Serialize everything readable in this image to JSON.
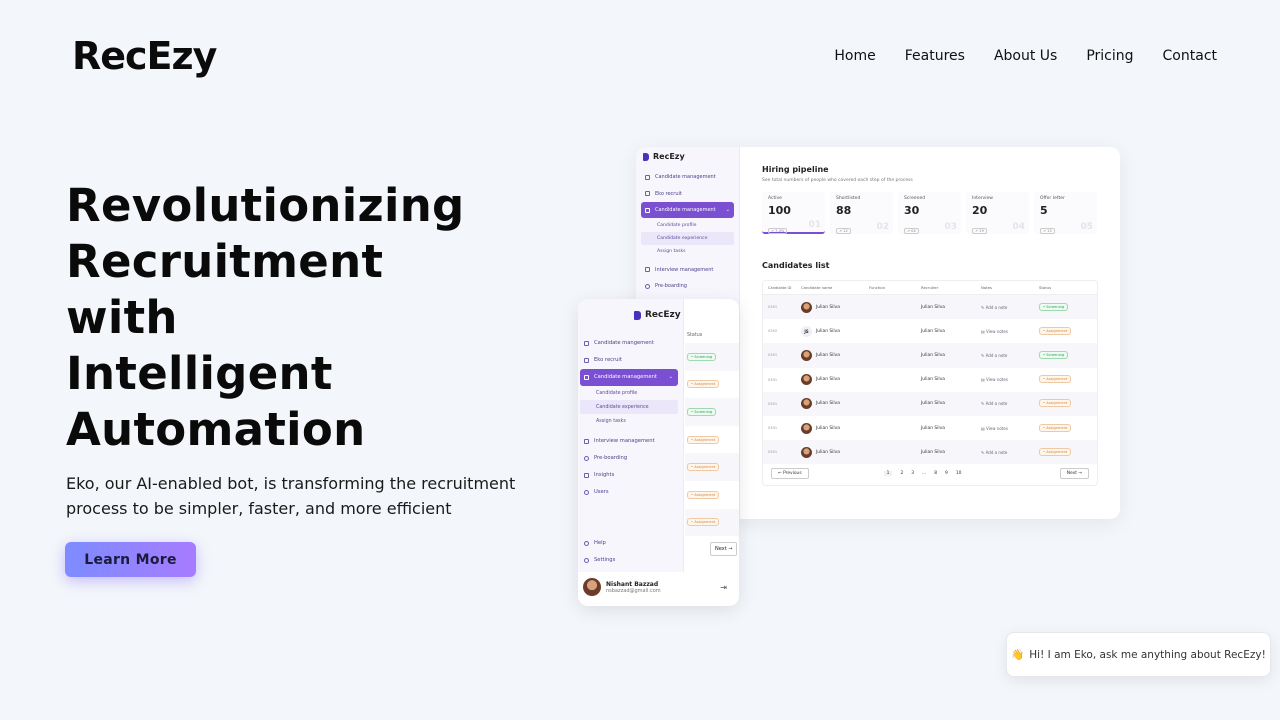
{
  "brand": "RecEzy",
  "nav": [
    "Home",
    "Features",
    "About Us",
    "Pricing",
    "Contact"
  ],
  "hero": {
    "lines": [
      "Revolutionizing",
      "Recruitment",
      "with",
      "Intelligent",
      "Automation"
    ],
    "subtitle": "Eko, our AI-enabled bot, is transforming the recruitment process to be simpler, faster, and more efficient",
    "cta": "Learn More"
  },
  "dashboard": {
    "brand": "RecEzy",
    "sidebar": [
      "Candidate management",
      "Eko recruit",
      "Candidate management",
      "Interview management",
      "Pre-boarding"
    ],
    "subitems": [
      "Candidate profile",
      "Candidate experience",
      "Assign tasks"
    ],
    "pipeline_title": "Hiring pipeline",
    "pipeline_subtitle": "See total numbers of people who covered each step of the process",
    "stats": [
      {
        "label": "Active",
        "value": "100",
        "change": "↗ 7.4%",
        "num": "01"
      },
      {
        "label": "Shortlisted",
        "value": "88",
        "change": "↗ 12",
        "num": "02"
      },
      {
        "label": "Screened",
        "value": "30",
        "change": "↗ 04",
        "num": "03"
      },
      {
        "label": "Interview",
        "value": "20",
        "change": "↗ 19",
        "num": "04"
      },
      {
        "label": "Offer letter",
        "value": "5",
        "change": "↗ 15",
        "num": "05"
      }
    ],
    "list_title": "Candidates list",
    "columns": [
      "Candidate ID",
      "Candidate name",
      "Function",
      "Recruiter",
      "Notes",
      "Status"
    ],
    "rows": [
      {
        "id": "0391",
        "name": "Julian Silva",
        "initials": "",
        "recruiter": "Julian Silva",
        "note": "✎ Add a note",
        "status": "• Screening"
      },
      {
        "id": "0392",
        "name": "Julian Silva",
        "initials": "JS",
        "recruiter": "Julian Silva",
        "note": "▤ View notes",
        "status": "• Assignment"
      },
      {
        "id": "0391",
        "name": "Julian Silva",
        "initials": "",
        "recruiter": "Julian Silva",
        "note": "✎ Add a note",
        "status": "• Screening"
      },
      {
        "id": "0391",
        "name": "Julian Silva",
        "initials": "",
        "recruiter": "Julian Silva",
        "note": "▤ View notes",
        "status": "• Assignment"
      },
      {
        "id": "0391",
        "name": "Julian Silva",
        "initials": "",
        "recruiter": "Julian Silva",
        "note": "✎ Add a note",
        "status": "• Assignment"
      },
      {
        "id": "0391",
        "name": "Julian Silva",
        "initials": "",
        "recruiter": "Julian Silva",
        "note": "▤ View notes",
        "status": "• Assignment"
      },
      {
        "id": "0391",
        "name": "Julian Silva",
        "initials": "",
        "recruiter": "Julian Silva",
        "note": "✎ Add a note",
        "status": "• Assignment"
      }
    ],
    "pager": {
      "prev": "← Previous",
      "pages": [
        "1",
        "2",
        "3",
        "...",
        "8",
        "9",
        "10"
      ],
      "next": "Next →"
    }
  },
  "mobile": {
    "brand": "RecEzy",
    "sidebar": [
      "Candidate mangement",
      "Eko recruit",
      "Candidate management",
      "Interview management",
      "Pre-boarding",
      "Insights",
      "Users"
    ],
    "subitems": [
      "Candidate profile",
      "Candidate experience",
      "Assign tasks"
    ],
    "bottom": [
      "Help",
      "Settings"
    ],
    "status_header": "Status",
    "statuses": [
      "• Screening",
      "• Assignment",
      "• Screening",
      "• Assignment",
      "• Assignment",
      "• Assignment",
      "• Assignment"
    ],
    "next": "Next →",
    "user": {
      "name": "Nishant Bazzad",
      "email": "nsbazzad@gmail.com"
    }
  },
  "chat": {
    "icon": "👋",
    "text": "Hi! I am Eko, ask me anything about RecEzy!"
  }
}
